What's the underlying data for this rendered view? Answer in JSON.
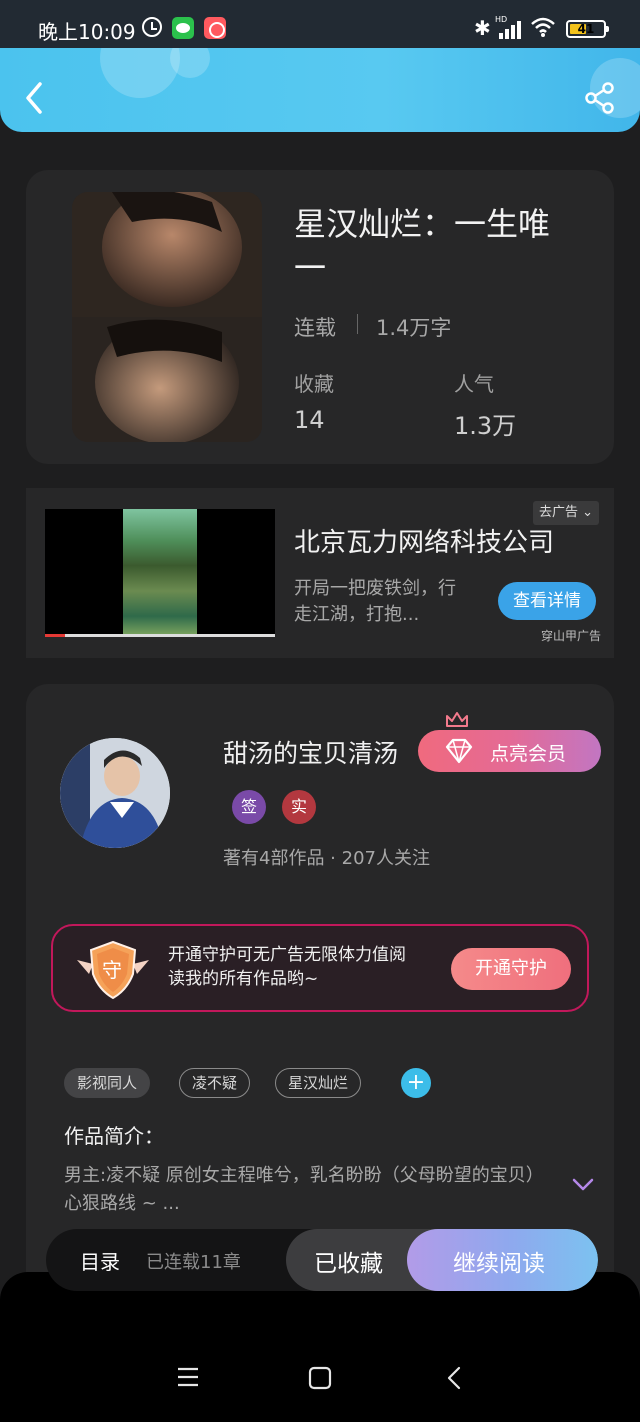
{
  "status_bar": {
    "time": "晚上10:09",
    "bluetooth": "✱",
    "signal_label": "HD",
    "battery": "41"
  },
  "header": {
    "back_icon": "chevron-left-icon",
    "share_icon": "share-icon"
  },
  "book": {
    "title": "星汉灿烂：一生唯一",
    "status": "连载",
    "words": "1.4万字",
    "favorites_label": "收藏",
    "favorites_value": "14",
    "popularity_label": "人气",
    "popularity_value": "1.3万"
  },
  "ad": {
    "close_label": "去广告 ⌄",
    "title": "北京瓦力网络科技公司",
    "desc": "开局一把废铁剑，行走江湖，打抱...",
    "button": "查看详情",
    "source": "穿山甲广告"
  },
  "author": {
    "name": "甜汤的宝贝清汤",
    "vip_button": "点亮会员",
    "badge_signed": "签",
    "badge_verified": "实",
    "meta": "著有4部作品 · 207人关注",
    "guard_text": "开通守护可无广告无限体力值阅读我的所有作品哟~",
    "guard_shield": "守",
    "guard_button": "开通守护"
  },
  "tags": [
    "影视同人",
    "凌不疑",
    "星汉灿烂"
  ],
  "tag_add": "+",
  "intro": {
    "title": "作品简介：",
    "text": "男主:凌不疑 原创女主程唯兮，乳名盼盼（父母盼望的宝贝）心狠路线 ~ ..."
  },
  "bottom_bar": {
    "toc": "目录",
    "chapters": "已连载11章",
    "favorited": "已收藏",
    "continue": "继续阅读"
  },
  "colors": {
    "header": "#4bc3ee",
    "card": "#272728",
    "vip_gradient_start": "#f06a7e",
    "accent_blue": "#3cbde9",
    "guard_border": "#c2185b"
  }
}
